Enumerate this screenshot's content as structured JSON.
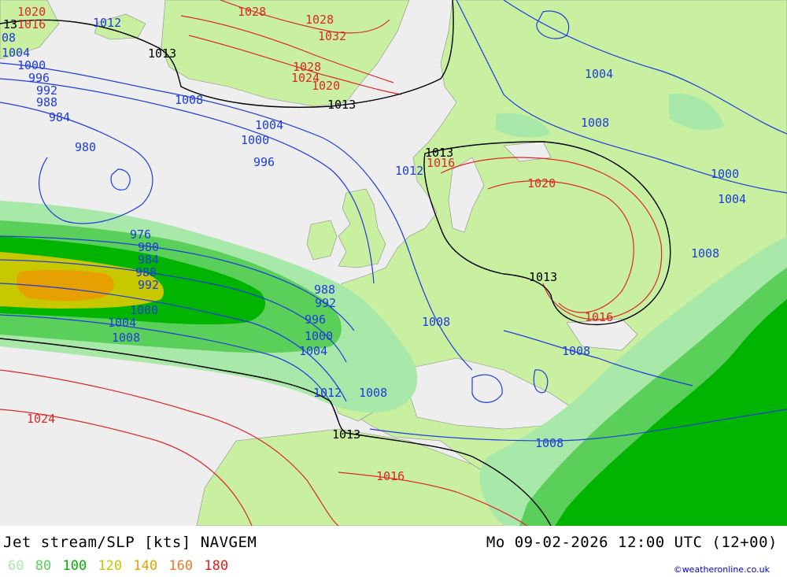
{
  "header": {
    "title": "Jet stream/SLP [kts] NAVGEM",
    "datetime": "Mo 09-02-2026 12:00 UTC (12+00)"
  },
  "legend": [
    {
      "label": "60",
      "color": "#a8e8a8"
    },
    {
      "label": "80",
      "color": "#5ad05a"
    },
    {
      "label": "100",
      "color": "#00b400"
    },
    {
      "label": "120",
      "color": "#c8c800"
    },
    {
      "label": "140",
      "color": "#e6a000"
    },
    {
      "label": "160",
      "color": "#f07828"
    },
    {
      "label": "180",
      "color": "#e61e1e"
    }
  ],
  "credit": "©weatheronline.co.uk",
  "colors": {
    "land": "#c8f0a0",
    "sea": "#eeeeee",
    "isobar_low": "#1e3cdc",
    "isobar_high": "#dc2828",
    "isobar_1013": "#000000"
  },
  "isobar_labels": {
    "blue": [
      "08",
      "1004",
      "1000",
      "996",
      "992",
      "988",
      "984",
      "980",
      "976",
      "980",
      "984",
      "988",
      "992",
      "1000",
      "1004",
      "1008",
      "1012",
      "1008",
      "1004",
      "1000",
      "996",
      "988",
      "992",
      "996",
      "1000",
      "1004",
      "1012",
      "1008",
      "1008",
      "1004",
      "1008",
      "1000",
      "1004",
      "1008",
      "1008",
      "1008",
      "1012"
    ],
    "red": [
      "1020",
      "1016",
      "1028",
      "1028",
      "1032",
      "1028",
      "1024",
      "1020",
      "1016",
      "1020",
      "1016",
      "1024",
      "1016"
    ],
    "black": [
      "13",
      "1013",
      "1013",
      "1013",
      "1013",
      "1013"
    ]
  }
}
